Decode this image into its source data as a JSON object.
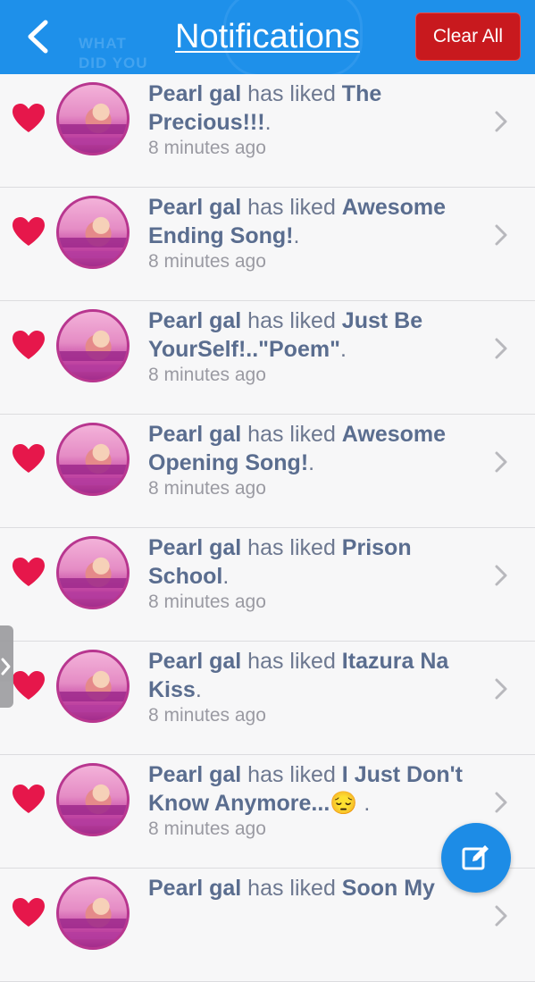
{
  "header": {
    "title": "Notifications",
    "clear_label": "Clear All",
    "background_text": "WHAT\nDID YOU",
    "color": "#1e90ea",
    "clear_color": "#c8191e"
  },
  "notifications": [
    {
      "user": "Pearl gal",
      "verb": " has liked ",
      "post": "The Precious!!!",
      "tail": ".",
      "time": "8 minutes ago"
    },
    {
      "user": "Pearl gal",
      "verb": " has liked ",
      "post": "Awesome Ending Song!",
      "tail": ".",
      "time": "8 minutes ago"
    },
    {
      "user": "Pearl gal",
      "verb": " has liked ",
      "post": "Just Be YourSelf!..\"Poem\"",
      "tail": ".",
      "time": "8 minutes ago"
    },
    {
      "user": "Pearl gal",
      "verb": " has liked ",
      "post": "Awesome Opening Song!",
      "tail": ".",
      "time": "8 minutes ago"
    },
    {
      "user": "Pearl gal",
      "verb": " has liked ",
      "post": "Prison School",
      "tail": ".",
      "time": "8 minutes ago"
    },
    {
      "user": "Pearl gal",
      "verb": " has liked ",
      "post": "Itazura Na Kiss",
      "tail": ".",
      "time": "8 minutes ago"
    },
    {
      "user": "Pearl gal",
      "verb": " has liked ",
      "post": "I Just Don't Know Anymore...😔",
      "tail": " .",
      "time": "8 minutes ago"
    },
    {
      "user": "Pearl gal",
      "verb": " has liked ",
      "post": "Soon My",
      "tail": "",
      "time": ""
    }
  ],
  "icons": {
    "back": "chevron-left-icon",
    "like": "heart-icon",
    "row_arrow": "chevron-right-icon",
    "compose": "compose-icon"
  },
  "colors": {
    "heart": "#e6174b",
    "link_text": "#5a6d8f",
    "time_text": "#9a9aa2"
  }
}
